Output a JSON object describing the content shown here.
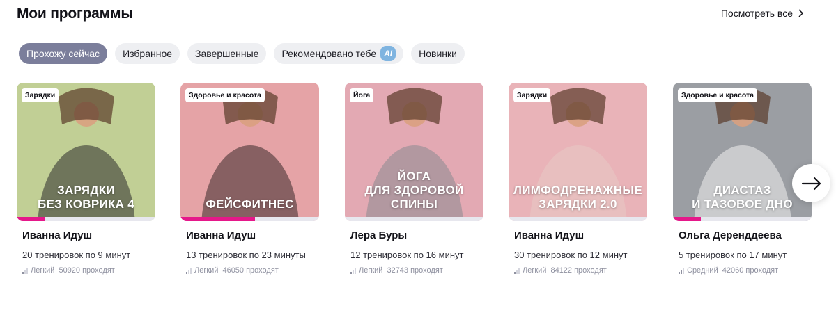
{
  "header": {
    "title": "Мои программы",
    "see_all": "Посмотреть все"
  },
  "tabs": [
    {
      "label": "Прохожу сейчас",
      "active": true
    },
    {
      "label": "Избранное",
      "active": false
    },
    {
      "label": "Завершенные",
      "active": false
    },
    {
      "label": "Рекомендовано тебе",
      "active": false,
      "badge": "AI"
    },
    {
      "label": "Новинки",
      "active": false
    }
  ],
  "cards": [
    {
      "category": "Зарядки",
      "cover_text_1": "Зарядки",
      "cover_text_2": "без коврика 4",
      "trainer": "Иванна Идуш",
      "count": "20 тренировок по 9 минут",
      "level": "Легкий",
      "participants": "50920 проходят",
      "progress": 0.2,
      "bg": "#c1cf95",
      "accent": "#2b2b2b"
    },
    {
      "category": "Здоровье и красота",
      "cover_text_1": "",
      "cover_text_2": "Фейсфитнес",
      "trainer": "Иванна Идуш",
      "count": "13 тренировок по 23 минуты",
      "level": "Легкий",
      "participants": "46050 проходят",
      "progress": 0.54,
      "bg": "#e5a3a6",
      "accent": "#3b2a2a"
    },
    {
      "category": "Йога",
      "cover_text_1": "Йога",
      "cover_text_2": "для здоровой спины",
      "trainer": "Лера Буры",
      "count": "12 тренировок по 16 минут",
      "level": "Легкий",
      "participants": "32743 проходят",
      "progress": 0,
      "bg": "#e3a9b3",
      "accent": "#8a8a90"
    },
    {
      "category": "Зарядки",
      "cover_text_1": "Лимфодренажные",
      "cover_text_2": "зарядки 2.0",
      "trainer": "Иванна Идуш",
      "count": "30 тренировок по 12 минут",
      "level": "Легкий",
      "participants": "84122 проходят",
      "progress": 0,
      "bg": "#e9b3b8",
      "accent": "#e7c9c4"
    },
    {
      "category": "Здоровье и красота",
      "cover_text_1": "Диастаз",
      "cover_text_2": "и тазовое дно",
      "trainer": "Ольга Деренддеева",
      "count": "5 тренировок по 17 минут",
      "level": "Средний",
      "participants": "42060 проходят",
      "progress": 0.2,
      "bg": "#9b9ea3",
      "accent": "#f1f1f1"
    }
  ]
}
